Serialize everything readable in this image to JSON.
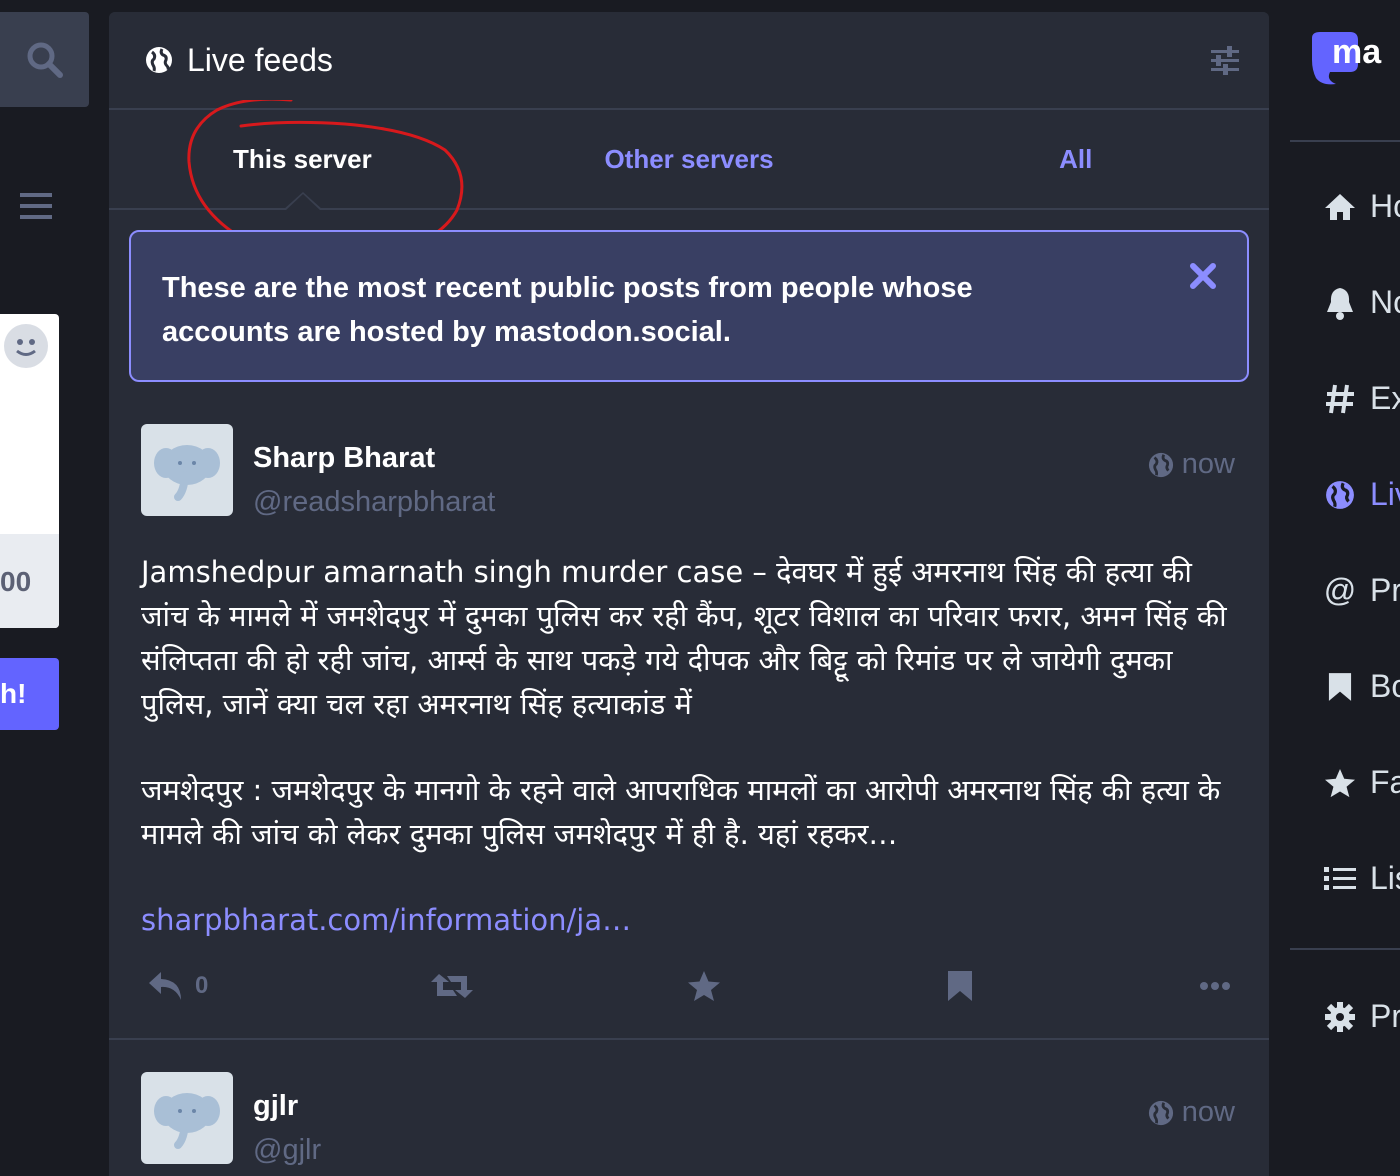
{
  "column": {
    "title": "Live feeds",
    "icon": "globe-icon",
    "settings_icon": "sliders-icon"
  },
  "tabs": [
    {
      "label": "This server",
      "active": true
    },
    {
      "label": "Other servers",
      "active": false
    },
    {
      "label": "All",
      "active": false
    }
  ],
  "banner": {
    "text": "These are the most recent public posts from people whose accounts are hosted by mastodon.social.",
    "close_icon": "close-icon"
  },
  "statuses": [
    {
      "display_name": "Sharp Bharat",
      "account": "@readsharpbharat",
      "time": "now",
      "paragraph1": "Jamshedpur amarnath singh murder case – देवघर में हुई अमरनाथ सिंह की हत्या की जांच के मामले में जमशेदपुर में दुमका पुलिस कर रही कैंप, शूटर विशाल का परिवार फरार, अमन सिंह की संलिप्तता की हो रही जांच, आर्म्स के साथ पकड़े गये दीपक और बिट्टू को रिमांड पर ले जायेगी दुमका पुलिस, जानें क्या चल रहा अमरनाथ सिंह हत्याकांड में",
      "paragraph2": "जमशेदपुर : जमशेदपुर के मानगो के रहने वाले आपराधिक मामलों का आरोपी अमरनाथ सिंह की हत्या के मामले की जांच को लेकर दुमका पुलिस जमशेदपुर में ही है. यहां रहकर…",
      "link": "sharpbharat.com/information/ja…",
      "reply_count": "0"
    },
    {
      "display_name": "gjlr",
      "account": "@gjlr",
      "time": "now"
    }
  ],
  "left": {
    "counter_fragment": "00",
    "button_fragment": "h!"
  },
  "nav": [
    {
      "label": "Ho",
      "icon": "home-icon",
      "active": false
    },
    {
      "label": "No",
      "icon": "bell-icon",
      "active": false
    },
    {
      "label": "Ex",
      "icon": "hashtag-icon",
      "active": false
    },
    {
      "label": "Liv",
      "icon": "globe-icon",
      "active": true
    },
    {
      "label": "Pr",
      "icon": "at-icon",
      "active": false
    },
    {
      "label": "Bo",
      "icon": "bookmark-icon",
      "active": false
    },
    {
      "label": "Fa",
      "icon": "star-icon",
      "active": false
    },
    {
      "label": "Lis",
      "icon": "list-icon",
      "active": false
    },
    {
      "label": "Pr",
      "icon": "gear-icon",
      "active": false
    }
  ],
  "logo_fragment": "ma",
  "colors": {
    "background": "#191b22",
    "column": "#282c37",
    "accent": "#8c8dff",
    "brand": "#6364ff",
    "annotation": "#d7191c"
  }
}
